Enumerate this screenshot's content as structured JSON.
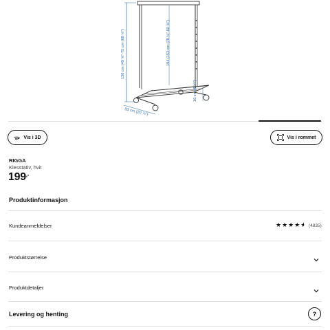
{
  "image": {
    "dimensions": {
      "height_total": "136 cm (49 ⅝\"-75 cm (68 ⅛\")",
      "height_rail": "194 (153 cm (78 ⅜\"-60 ⅝\")",
      "width": "93 cm (20 ⅞\")",
      "shelf_height": "16 cm (6 ¼\")"
    }
  },
  "buttons": {
    "view_3d": "Vis i 3D",
    "view_in_room": "Vis i rommet"
  },
  "product": {
    "name": "RIGGA",
    "description": "Klesstativ, hvit",
    "price": "199",
    "price_suffix": ",-"
  },
  "sections": {
    "info_title": "Produktinformasjon",
    "reviews_label": "Kundeanmeldelser",
    "rating": 4.5,
    "review_count": "(4835)",
    "size_label": "Produktstørrelse",
    "details_label": "Produktdetaljer",
    "delivery_title": "Levering og henting",
    "help_symbol": "?"
  },
  "colors": {
    "text": "#111111",
    "dimension_lines": "#2f6db0",
    "divider": "#dfdfdf"
  }
}
